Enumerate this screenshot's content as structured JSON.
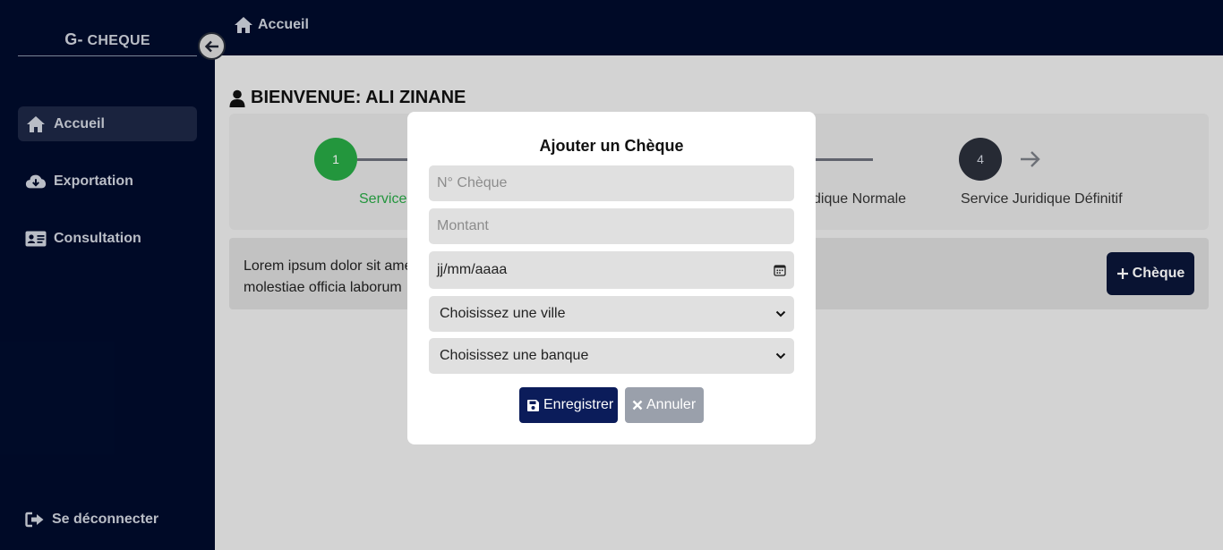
{
  "sidebar": {
    "brand_prefix": "G-",
    "brand_name": "CHEQUE",
    "items": [
      {
        "label": "Accueil",
        "icon": "home-icon",
        "active": true
      },
      {
        "label": "Exportation",
        "icon": "cloud-download-icon",
        "active": false
      },
      {
        "label": "Consultation",
        "icon": "id-card-icon",
        "active": false
      }
    ],
    "logout_label": "Se déconnecter"
  },
  "topbar": {
    "breadcrumb": "Accueil"
  },
  "main": {
    "welcome": "BIENVENUE: ALI ZINANE",
    "steps": [
      {
        "number": "1",
        "label": "Service",
        "status": "done",
        "color": "#28a745"
      },
      {
        "number": "4",
        "label": "Service Juridique Définitif",
        "status": "pending",
        "color": "#2b2f3a"
      }
    ],
    "step3_label_partial": "dique Normale",
    "info_text_line1": "Lorem ipsum dolor sit amet",
    "info_text_line2": "molestiae officia laborum",
    "add_button": "Chèque"
  },
  "modal": {
    "title": "Ajouter un Chèque",
    "cheque_number_placeholder": "N° Chèque",
    "amount_placeholder": "Montant",
    "date_placeholder": "jj/mm/aaaa",
    "city_select": "Choisissez une ville",
    "bank_select": "Choisissez une banque",
    "save_label": "Enregistrer",
    "cancel_label": "Annuler"
  },
  "colors": {
    "sidebar_bg": "#000c2c",
    "primary_button": "#0b1c5a",
    "cancel_button": "#9aa0ab",
    "step_done": "#28a745"
  }
}
